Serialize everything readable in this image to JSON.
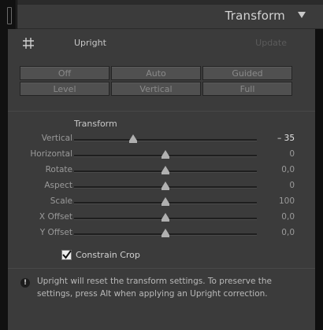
{
  "header": {
    "title": "Transform"
  },
  "upright": {
    "label": "Upright",
    "update_label": "Update",
    "buttons": [
      "Off",
      "Auto",
      "Guided",
      "Level",
      "Vertical",
      "Full"
    ]
  },
  "transform": {
    "section_label": "Transform",
    "range": [
      -100,
      100
    ],
    "sliders": [
      {
        "label": "Vertical",
        "value": "– 35",
        "numeric": -35,
        "active": true
      },
      {
        "label": "Horizontal",
        "value": "0",
        "numeric": 0
      },
      {
        "label": "Rotate",
        "value": "0,0",
        "numeric": 0
      },
      {
        "label": "Aspect",
        "value": "0",
        "numeric": 0
      },
      {
        "label": "Scale",
        "value": "100",
        "numeric": 0
      },
      {
        "label": "X Offset",
        "value": "0,0",
        "numeric": 0
      },
      {
        "label": "Y Offset",
        "value": "0,0",
        "numeric": 0
      }
    ]
  },
  "constrain_crop": {
    "label": "Constrain Crop",
    "checked": true
  },
  "info": {
    "text": "Upright will reset the transform settings. To preserve the settings, press Alt when applying an Upright correction."
  }
}
